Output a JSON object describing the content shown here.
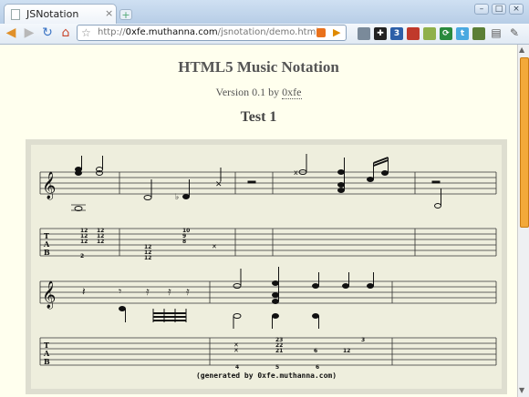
{
  "window": {
    "tab_title": "JSNotation",
    "tab_close": "×",
    "new_tab": "+",
    "controls": {
      "minimize": "–",
      "maximize": "□",
      "close": "×"
    }
  },
  "toolbar": {
    "icons": [
      "back-arrow-icon",
      "forward-arrow-icon",
      "reload-icon",
      "home-icon"
    ],
    "url_prefix": "http://",
    "url_domain": "0xfe.muthanna.com",
    "url_path": "/jsnotation/demo.html",
    "extensions": [
      "bookmark-icon",
      "plus-icon",
      "counter-icon",
      "pdf-icon",
      "ext-green-icon",
      "refresh-ext-icon",
      "twitter-icon",
      "evernote-icon"
    ],
    "extension_badge": "3"
  },
  "page": {
    "title": "HTML5 Music Notation",
    "version_prefix": "Version 0.1 by ",
    "author": "0xfe",
    "test_title": "Test 1",
    "generated_by": "(generated by 0xfe.muthanna.com)"
  },
  "tab_numbers": {
    "row1": [
      "12",
      "12",
      "12",
      "12",
      "12",
      "12",
      "2",
      "10",
      "9",
      "8",
      "12",
      "12",
      "12"
    ],
    "row2": [
      "23",
      "22",
      "21",
      "6",
      "12",
      "3",
      "4",
      "5",
      "6"
    ]
  },
  "colors": {
    "page_bg": "#ffffee",
    "score_bg": "#eeeedd",
    "accent": "#f3a93a"
  }
}
